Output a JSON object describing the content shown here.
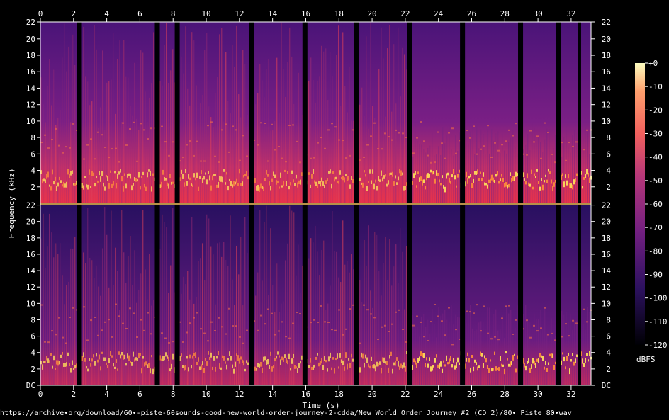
{
  "chart_data": {
    "type": "heatmap",
    "xlabel": "Time (s)",
    "ylabel": "Frequency (kHz)",
    "x_ticks": [
      "0",
      "2",
      "4",
      "6",
      "8",
      "10",
      "12",
      "14",
      "16",
      "18",
      "20",
      "22",
      "24",
      "26",
      "28",
      "30",
      "32"
    ],
    "x_range": [
      0,
      33.2
    ],
    "channels": [
      {
        "y_ticks": [
          "22",
          "20",
          "18",
          "16",
          "14",
          "12",
          "10",
          "8",
          "6",
          "4",
          "2"
        ],
        "y_range": [
          0,
          22.05
        ]
      },
      {
        "y_ticks": [
          "22",
          "20",
          "18",
          "16",
          "14",
          "12",
          "10",
          "8",
          "6",
          "4",
          "2",
          "DC"
        ],
        "y_range": [
          0,
          22.05
        ]
      }
    ],
    "colorbar": {
      "label": "dBFS",
      "ticks": [
        "+0",
        "-10",
        "-20",
        "-30",
        "-40",
        "-50",
        "-60",
        "-70",
        "-80",
        "-90",
        "-100",
        "-110",
        "-120"
      ],
      "range": [
        -120,
        0
      ]
    },
    "silent_gaps_s": [
      [
        2.2,
        2.5
      ],
      [
        6.9,
        7.2
      ],
      [
        8.1,
        8.4
      ],
      [
        12.6,
        12.9
      ],
      [
        15.8,
        16.1
      ],
      [
        18.9,
        19.2
      ],
      [
        22.1,
        22.4
      ],
      [
        25.3,
        25.6
      ],
      [
        28.8,
        29.1
      ],
      [
        31.1,
        31.4
      ],
      [
        32.4,
        32.6
      ]
    ],
    "colors": {
      "low": "#000004",
      "mid": "#8c2981",
      "high": "#fe9f6d",
      "peak": "#fcfdbf"
    }
  },
  "source": "https://archive•org/download/60•-piste-60sounds-good-new-world-order-journey-2-cdda/New World Order Journey #2 (CD 2)/80• Piste 80•wav"
}
